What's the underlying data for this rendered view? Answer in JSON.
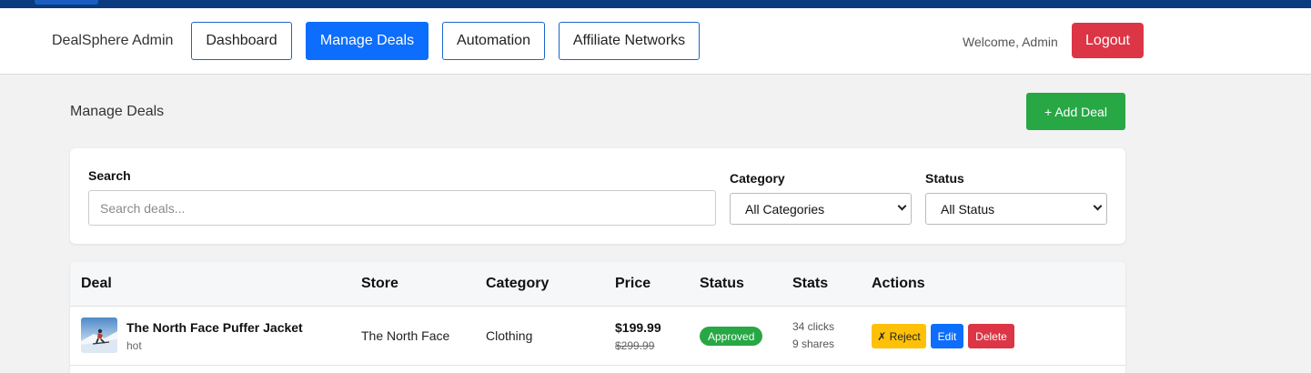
{
  "nav": {
    "brand": "DealSphere Admin",
    "links": [
      "Dashboard",
      "Manage Deals",
      "Automation",
      "Affiliate Networks"
    ],
    "active": "Manage Deals",
    "welcome": "Welcome, Admin",
    "logout": "Logout"
  },
  "page": {
    "title": "Manage Deals",
    "add_button": "+ Add Deal"
  },
  "filters": {
    "search_label": "Search",
    "search_placeholder": "Search deals...",
    "category_label": "Category",
    "category_selected": "All Categories",
    "status_label": "Status",
    "status_selected": "All Status"
  },
  "table": {
    "headers": [
      "Deal",
      "Store",
      "Category",
      "Price",
      "Status",
      "Stats",
      "Actions"
    ],
    "rows": [
      {
        "title": "The North Face Puffer Jacket",
        "tag": "hot",
        "store": "The North Face",
        "category": "Clothing",
        "price": "$199.99",
        "original_price": "$299.99",
        "status": "Approved",
        "clicks": "34 clicks",
        "shares": "9 shares",
        "actions": [
          "✗ Reject",
          "Edit",
          "Delete"
        ]
      }
    ]
  },
  "colors": {
    "primary": "#0d6efd",
    "success": "#28a745",
    "danger": "#dc3545",
    "warning": "#ffc107",
    "topbar": "#0b3a7e"
  },
  "icons": {
    "deal_thumbnail": "skier-photo-thumbnail"
  }
}
